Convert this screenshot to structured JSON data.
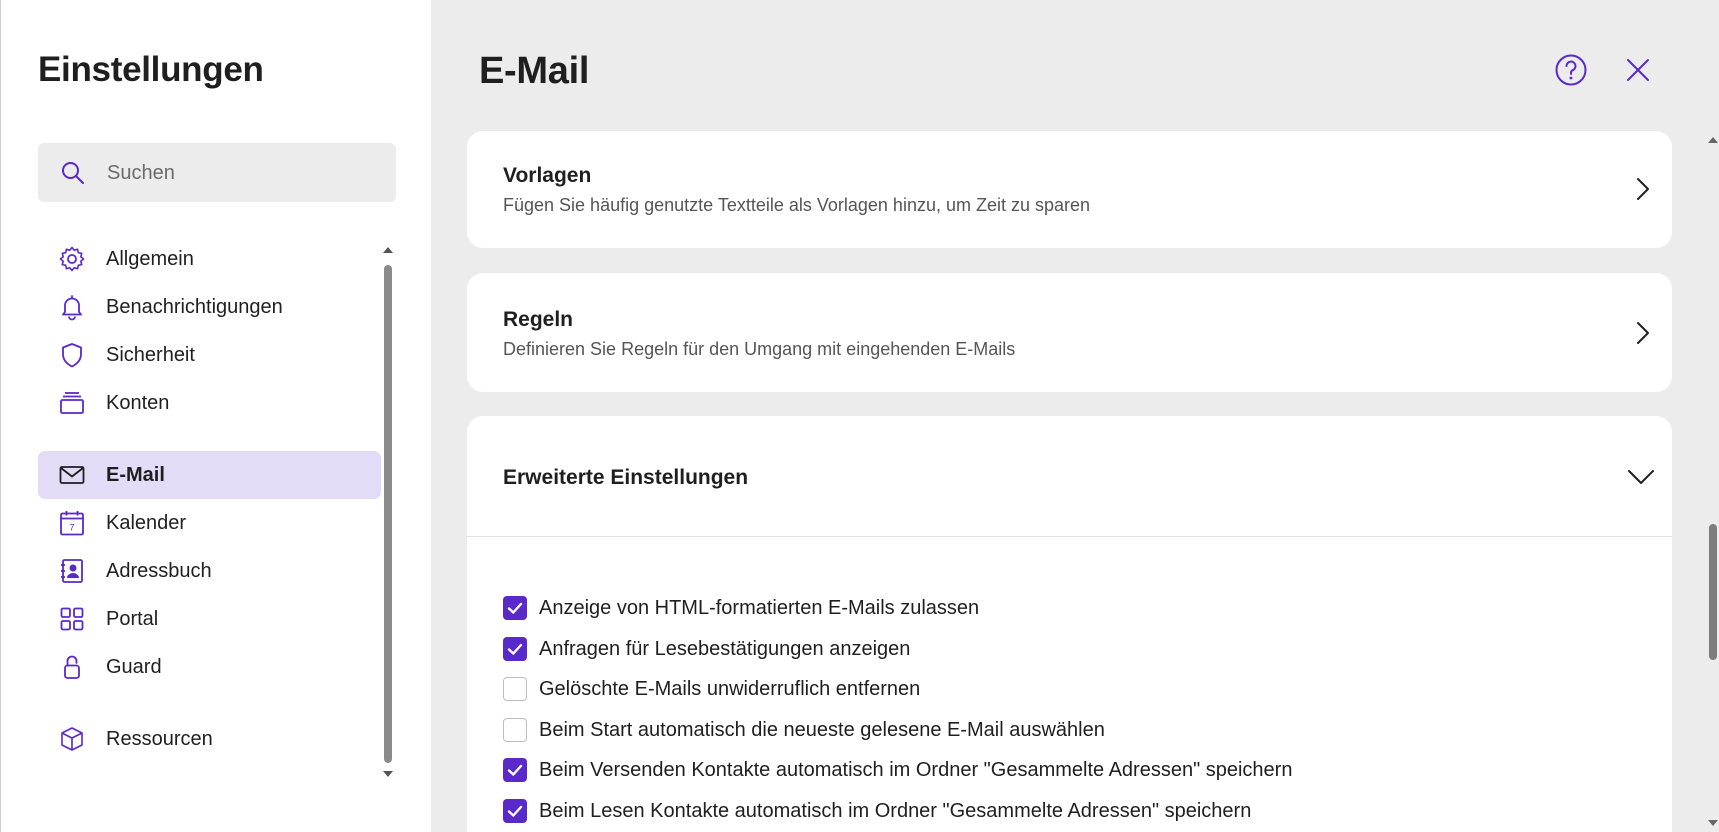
{
  "sidebar": {
    "title": "Einstellungen",
    "search": {
      "placeholder": "Suchen"
    },
    "items": [
      {
        "label": "Allgemein",
        "icon": "gear-icon"
      },
      {
        "label": "Benachrichtigungen",
        "icon": "bell-icon"
      },
      {
        "label": "Sicherheit",
        "icon": "shield-icon"
      },
      {
        "label": "Konten",
        "icon": "accounts-icon"
      },
      {
        "label": "E-Mail",
        "icon": "mail-icon",
        "active": true
      },
      {
        "label": "Kalender",
        "icon": "calendar-icon",
        "badge": "7"
      },
      {
        "label": "Adressbuch",
        "icon": "address-book-icon"
      },
      {
        "label": "Portal",
        "icon": "grid-icon"
      },
      {
        "label": "Guard",
        "icon": "lock-icon"
      },
      {
        "label": "Ressourcen",
        "icon": "cube-icon"
      }
    ]
  },
  "main": {
    "title": "E-Mail",
    "cards": [
      {
        "title": "Vorlagen",
        "description": "Fügen Sie häufig genutzte Textteile als Vorlagen hinzu, um Zeit zu sparen"
      },
      {
        "title": "Regeln",
        "description": "Definieren Sie Regeln für den Umgang mit eingehenden E-Mails"
      }
    ],
    "advanced": {
      "title": "Erweiterte Einstellungen",
      "options": [
        {
          "label": "Anzeige von HTML-formatierten E-Mails zulassen",
          "checked": true
        },
        {
          "label": "Anfragen für Lesebestätigungen anzeigen",
          "checked": true
        },
        {
          "label": "Gelöschte E-Mails unwiderruflich entfernen",
          "checked": false
        },
        {
          "label": "Beim Start automatisch die neueste gelesene E-Mail auswählen",
          "checked": false
        },
        {
          "label": "Beim Versenden Kontakte automatisch im Ordner \"Gesammelte Adressen\" speichern",
          "checked": true
        },
        {
          "label": "Beim Lesen Kontakte automatisch im Ordner \"Gesammelte Adressen\" speichern",
          "checked": true
        }
      ]
    }
  },
  "colors": {
    "accent": "#5a29c9",
    "active_bg": "#e3dcf6",
    "page_bg": "#ececec"
  }
}
